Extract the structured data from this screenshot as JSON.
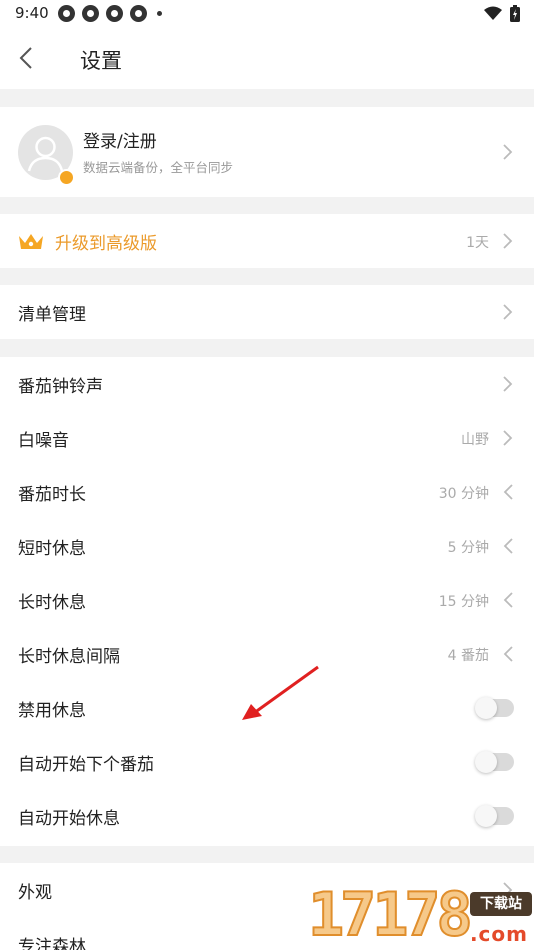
{
  "status_bar": {
    "time": "9:40"
  },
  "header": {
    "title": "设置"
  },
  "account": {
    "title": "登录/注册",
    "subtitle": "数据云端备份，全平台同步"
  },
  "upgrade": {
    "label": "升级到高级版",
    "value": "1天"
  },
  "lists": {
    "label": "清单管理"
  },
  "pomodoro": {
    "items": [
      {
        "label": "番茄钟铃声",
        "value": ""
      },
      {
        "label": "白噪音",
        "value": "山野"
      },
      {
        "label": "番茄时长",
        "value": "30 分钟"
      },
      {
        "label": "短时休息",
        "value": "5 分钟"
      },
      {
        "label": "长时休息",
        "value": "15 分钟"
      },
      {
        "label": "长时休息间隔",
        "value": "4 番茄"
      }
    ],
    "toggles": [
      {
        "label": "禁用休息",
        "on": false
      },
      {
        "label": "自动开始下个番茄",
        "on": false
      },
      {
        "label": "自动开始休息",
        "on": false
      }
    ]
  },
  "misc": {
    "items": [
      {
        "label": "外观"
      },
      {
        "label": "专注森林"
      }
    ]
  },
  "watermark": {
    "number": "17178",
    "tag": "下载站",
    "domain": ".com"
  },
  "colors": {
    "accent": "#eb9a2a",
    "background": "#f2f2f2",
    "arrow": "#e02020"
  }
}
